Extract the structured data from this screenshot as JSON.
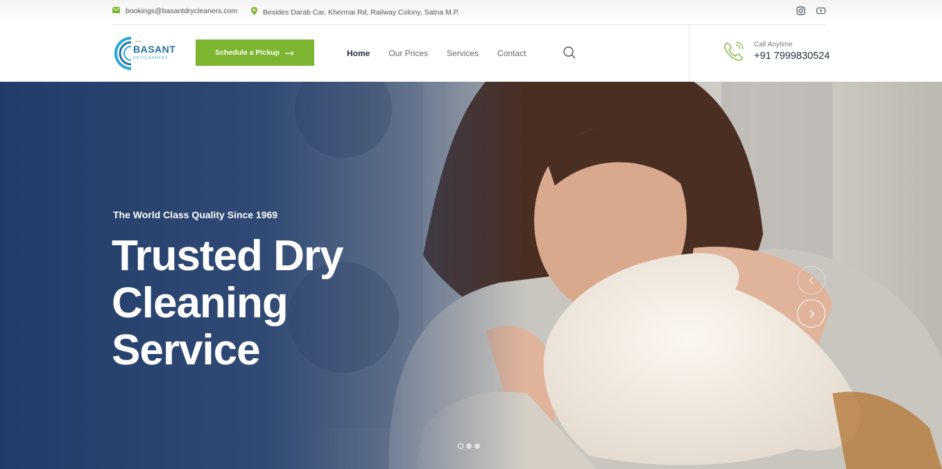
{
  "topbar": {
    "email": "bookings@basantdrycleaners.com",
    "address": "Besides Darab Car, Khermai Rd, Railway Colony, Satna M.P.",
    "email_icon": "envelope-icon",
    "address_icon": "map-pin-icon",
    "social": [
      "instagram-icon",
      "youtube-icon"
    ]
  },
  "header": {
    "logo": {
      "name": "BASANT",
      "sub": "DRYCLEANERS",
      "small": "since"
    },
    "cta_label": "Schedule a Pickup",
    "nav": [
      {
        "label": "Home",
        "active": true
      },
      {
        "label": "Our Prices",
        "active": false
      },
      {
        "label": "Services",
        "active": false
      },
      {
        "label": "Contact",
        "active": false
      }
    ],
    "call_label": "Call Anytime",
    "call_number": "+91 7999830524"
  },
  "hero": {
    "tagline": "The World Class Quality Since 1969",
    "title": "Trusted Dry Cleaning Service",
    "slide_count": 3,
    "active_slide": 1
  },
  "colors": {
    "accent_green": "#7cb631",
    "brand_blue": "#1f6fa3",
    "hero_overlay": "#1f3a68",
    "text_dark": "#1f2d3d"
  }
}
